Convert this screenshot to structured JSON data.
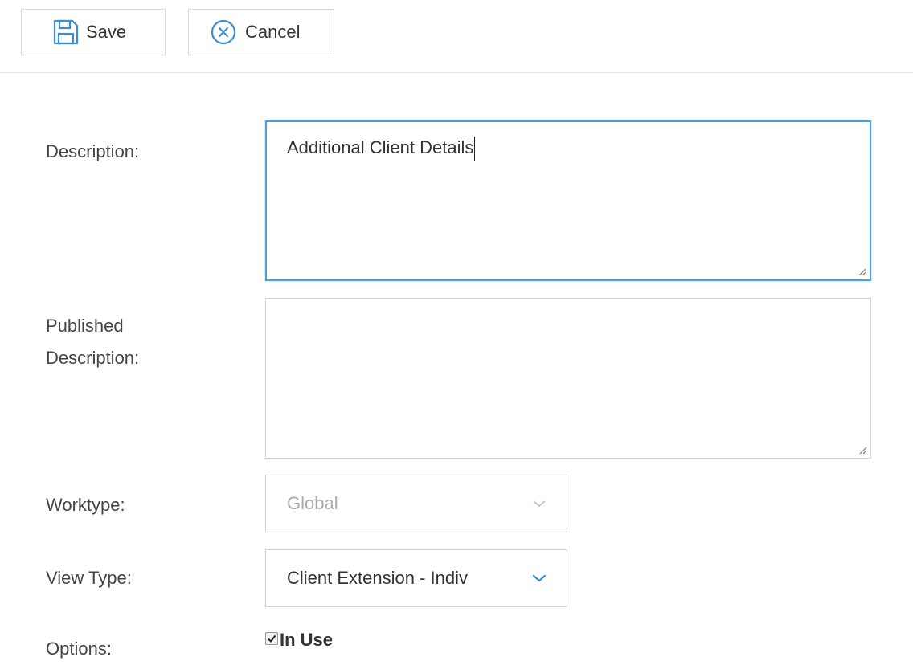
{
  "toolbar": {
    "save_label": "Save",
    "cancel_label": "Cancel"
  },
  "form": {
    "description": {
      "label": "Description:",
      "value": "Additional Client Details"
    },
    "published_description": {
      "label_line1": "Published",
      "label_line2": "Description:",
      "value": ""
    },
    "worktype": {
      "label": "Worktype:",
      "value": "Global",
      "disabled": true
    },
    "view_type": {
      "label": "View Type:",
      "value": "Client Extension - Indiv"
    },
    "options": {
      "label": "Options:",
      "in_use_label": "In Use",
      "in_use_checked": true
    }
  },
  "colors": {
    "accent": "#4a9fd8",
    "icon_blue": "#3a8fd3",
    "border": "#cfd3d6",
    "label_text": "#444444",
    "disabled_text": "#a9a9a9"
  },
  "icons": {
    "save": "floppy-disk-icon",
    "cancel": "circle-x-icon",
    "dropdown": "chevron-down-icon",
    "check": "checkmark-icon"
  }
}
